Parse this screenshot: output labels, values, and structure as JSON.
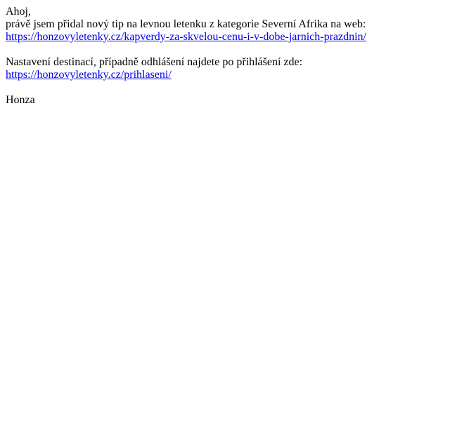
{
  "email": {
    "greeting": "Ahoj,",
    "intro": "právě jsem přidal nový tip na levnou letenku z kategorie Severní Afrika na web:",
    "tip_link": "https://honzovyletenky.cz/kapverdy-za-skvelou-cenu-i-v-dobe-jarnich-prazdnin/",
    "settings_text": "Nastavení destinací, případně odhlášení najdete po přihlášení zde:",
    "login_link": "https://honzovyletenky.cz/prihlaseni/",
    "signature": "Honza"
  },
  "colors": {
    "text": "#000000",
    "link": "#0000ee",
    "background": "#ffffff"
  }
}
